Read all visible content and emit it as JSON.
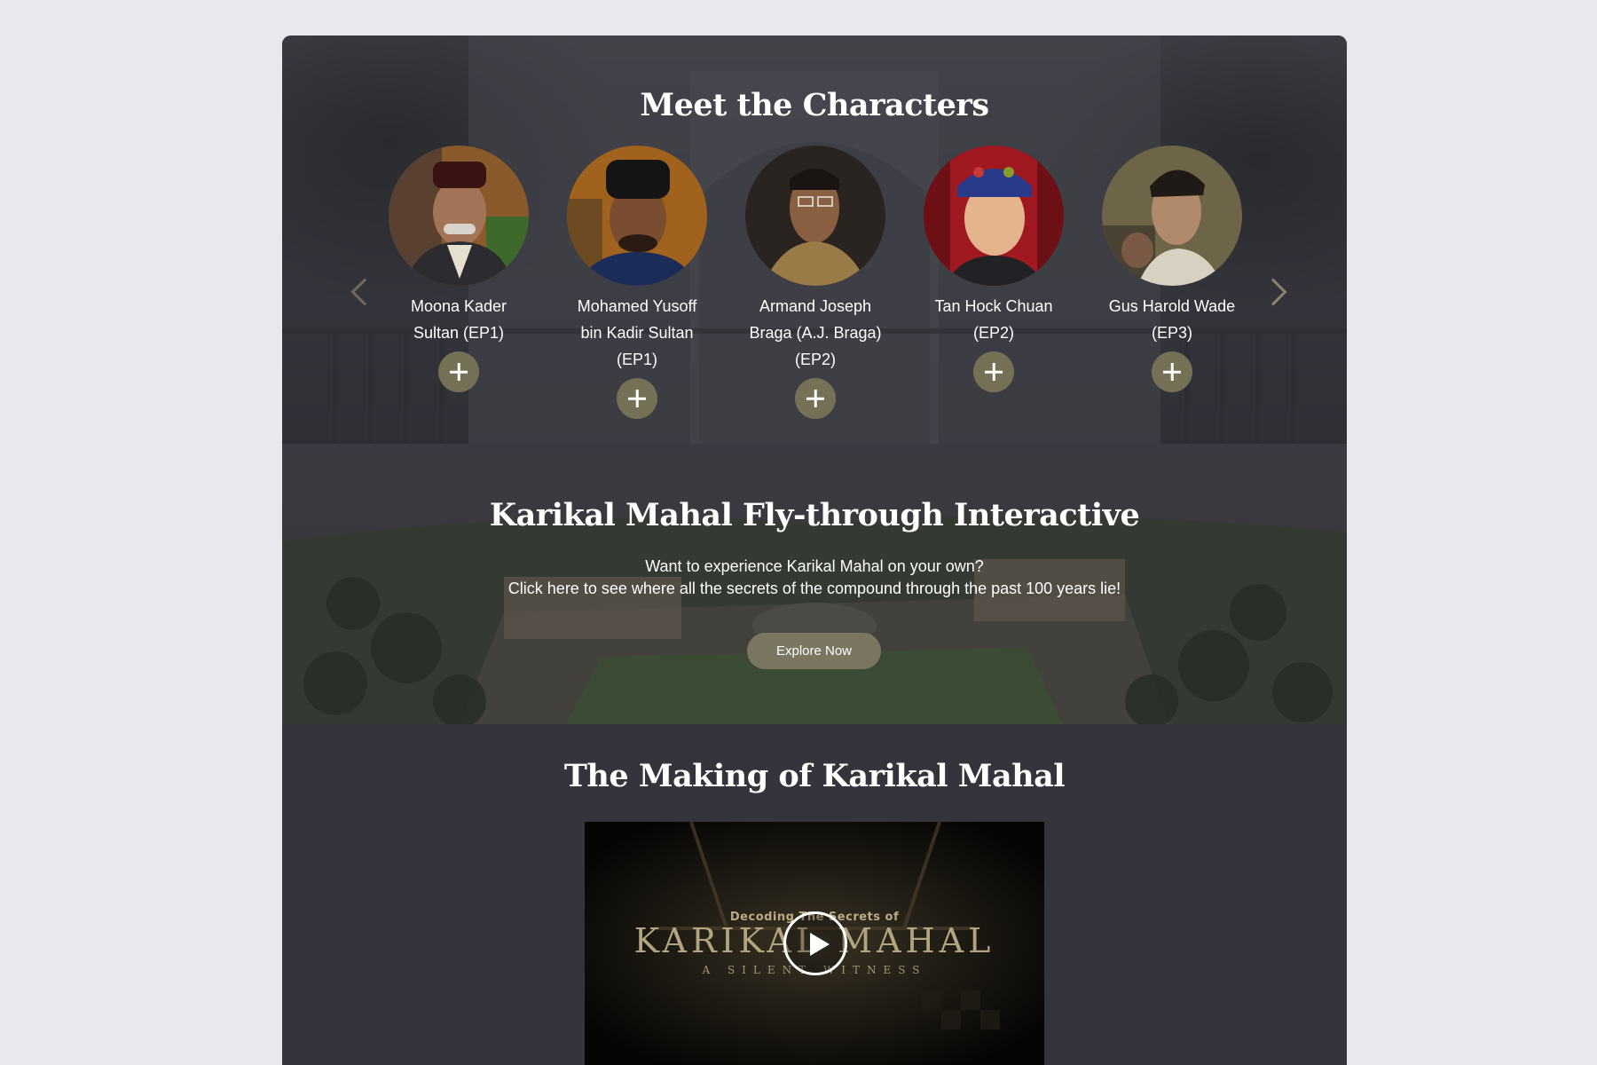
{
  "characters_section": {
    "title": "Meet the Characters",
    "prev_icon": "chevron-left-icon",
    "next_icon": "chevron-right-icon",
    "more_icon": "plus-icon",
    "people": [
      {
        "name": "Moona Kader Sultan (EP1)",
        "lines": [
          "Moona Kader",
          "Sultan (EP1)"
        ]
      },
      {
        "name": "Mohamed Yusoff bin Kadir Sultan (EP1)",
        "lines": [
          "Mohamed Yusoff",
          "bin Kadir Sultan",
          "(EP1)"
        ]
      },
      {
        "name": "Armand Joseph Braga (A.J. Braga) (EP2)",
        "lines": [
          "Armand Joseph",
          "Braga (A.J. Braga)",
          "(EP2)"
        ]
      },
      {
        "name": "Tan Hock Chuan (EP2)",
        "lines": [
          "Tan Hock Chuan",
          "(EP2)"
        ]
      },
      {
        "name": "Gus Harold Wade (EP3)",
        "lines": [
          "Gus Harold Wade",
          "(EP3)"
        ]
      }
    ]
  },
  "flythrough_section": {
    "title": "Karikal Mahal Fly-through Interactive",
    "line1": "Want to experience Karikal Mahal on your own?",
    "line2": "Click here to see where all the secrets of the compound through the past 100 years lie!",
    "button_label": "Explore Now"
  },
  "making_section": {
    "title": "The Making of Karikal Mahal",
    "video": {
      "kicker": "Decoding The Secrets of",
      "title": "KARIKAL MAHAL",
      "subtitle": "A SILENT WITNESS",
      "play_icon": "play-icon"
    }
  },
  "colors": {
    "page_bg": "#e8e9ed",
    "card_bg": "#34343c",
    "accent_button": "#757157",
    "text": "#ffffff"
  }
}
